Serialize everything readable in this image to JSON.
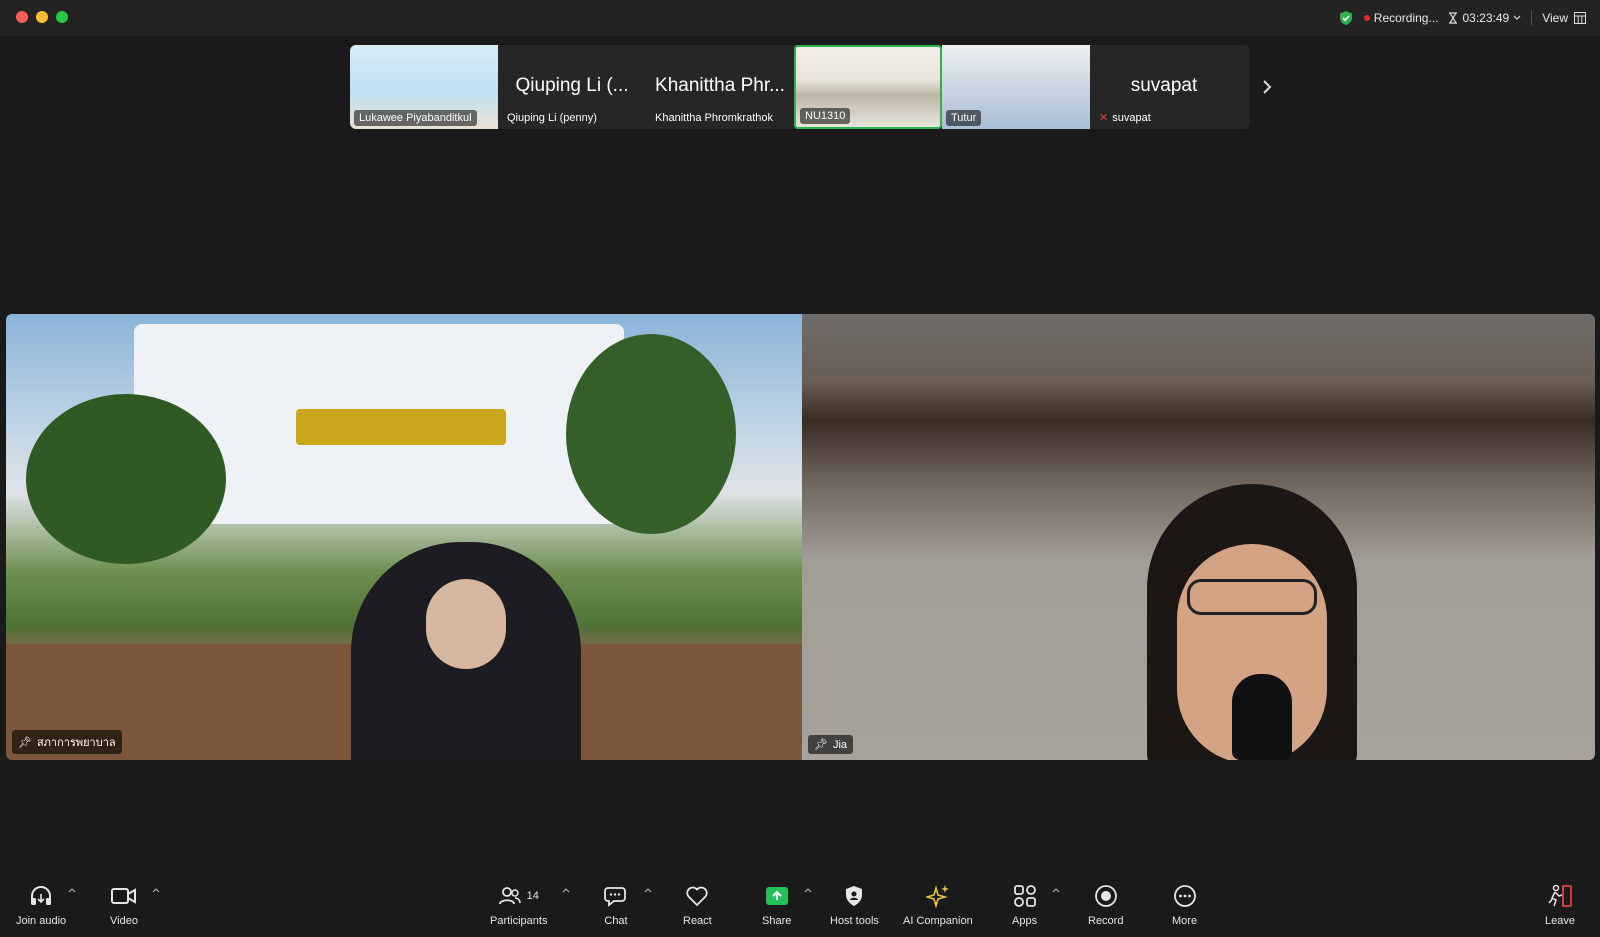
{
  "titlebar": {
    "recording_label": "Recording...",
    "timer": "03:23:49",
    "view_label": "View",
    "icons": [
      "security-shield-icon",
      "recording-dot-icon",
      "hourglass-icon",
      "chevron-down-icon",
      "grid-view-icon"
    ]
  },
  "thumbnails": [
    {
      "big_name": "",
      "label": "Lukawee Piyabanditkul",
      "has_video": true
    },
    {
      "big_name": "Qiuping Li (...",
      "label": "Qiuping Li (penny)",
      "has_video": false
    },
    {
      "big_name": "Khanittha Phr...",
      "label": "Khanittha Phromkrathok",
      "has_video": false
    },
    {
      "big_name": "",
      "label": "NU1310",
      "has_video": true,
      "active": true
    },
    {
      "big_name": "",
      "label": "Tutur",
      "has_video": true
    },
    {
      "big_name": "suvapat",
      "label": "suvapat",
      "has_video": false,
      "muted": true
    }
  ],
  "main_tiles": [
    {
      "label": "สภาการพยาบาล",
      "pinned": true
    },
    {
      "label": "Jia",
      "pinned": true
    }
  ],
  "toolbar": {
    "join_audio": "Join audio",
    "video": "Video",
    "participants": "Participants",
    "participants_count": "14",
    "chat": "Chat",
    "react": "React",
    "share": "Share",
    "host_tools": "Host tools",
    "ai_companion": "AI Companion",
    "apps": "Apps",
    "record": "Record",
    "more": "More",
    "leave": "Leave"
  },
  "colors": {
    "active_border": "#2fb14a",
    "share_green": "#21c05a",
    "record_red": "#e02b2b",
    "ai_gold": "#e9c23a",
    "leave_red": "#e0443b"
  }
}
